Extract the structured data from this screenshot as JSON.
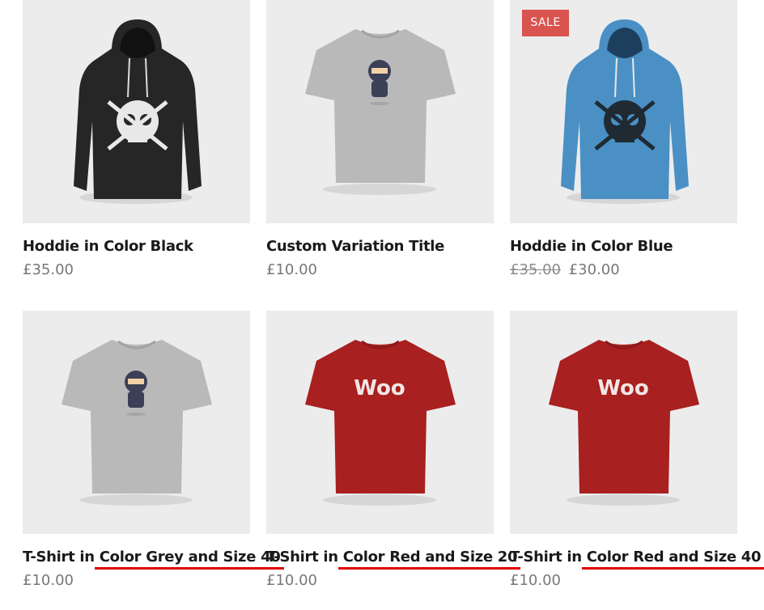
{
  "sale_badge": "SALE",
  "products": [
    {
      "image": "black-hoodie-skull",
      "title": "Hoddie in Color Black",
      "title_prefix": "",
      "title_highlight": "",
      "price": "£35.00",
      "old_price": ""
    },
    {
      "image": "grey-tshirt-ninja",
      "title": "Custom Variation Title",
      "title_prefix": "",
      "title_highlight": "",
      "price": "£10.00",
      "old_price": ""
    },
    {
      "image": "blue-hoodie-skull",
      "title": "Hoddie in Color Blue",
      "title_prefix": "",
      "title_highlight": "",
      "price": "£30.00",
      "old_price": "£35.00",
      "on_sale": true
    },
    {
      "image": "grey-tshirt-ninja",
      "title_prefix": "T-Shirt in ",
      "title_highlight": "Color Grey and Size 40",
      "price": "£10.00",
      "old_price": ""
    },
    {
      "image": "red-tshirt-woo",
      "title_prefix": "T-Shirt in ",
      "title_highlight": "Color Red and Size 20",
      "price": "£10.00",
      "old_price": ""
    },
    {
      "image": "red-tshirt-woo",
      "title_prefix": "T-Shirt in ",
      "title_highlight": "Color Red and Size 40",
      "price": "£10.00",
      "old_price": ""
    }
  ],
  "image_texts": {
    "woo_logo": "Woo"
  },
  "colors": {
    "thumb_bg": "#ececec",
    "sale": "#d9534f",
    "underline": "#e00000",
    "hoodie_black": "#262626",
    "hoodie_blue": "#4a90c4",
    "tshirt_grey": "#b9b9b9",
    "tshirt_red": "#a8201f"
  }
}
